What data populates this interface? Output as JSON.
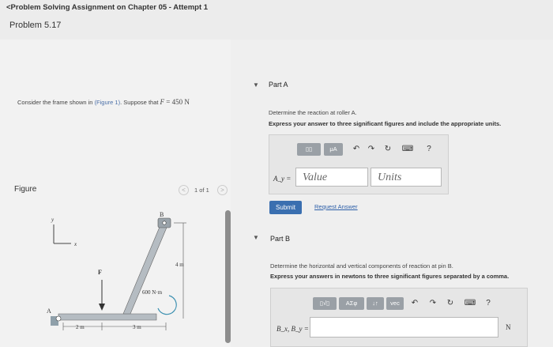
{
  "header": {
    "back_link": "<Problem Solving Assignment on Chapter 05 - Attempt 1",
    "problem_title": "Problem 5.17"
  },
  "question": {
    "prefix": "Consider the frame shown in ",
    "figure_link": "(Figure 1)",
    "middle": ". Suppose that ",
    "var": "F",
    "eq": " = 450 N"
  },
  "figure_panel": {
    "label": "Figure",
    "prev": "<",
    "count": "1 of 1",
    "next": ">"
  },
  "figure": {
    "label_y": "y",
    "label_x": "x",
    "label_B": "B",
    "label_A": "A",
    "label_F": "F",
    "label_4m": "4 m",
    "label_moment": "600 N·m",
    "label_2m": "2 m",
    "label_3m": "3 m"
  },
  "part_a": {
    "caret": "▼",
    "title": "Part A",
    "instruction": "Determine the reaction at roller A.",
    "bold_instruction": "Express your answer to three significant figures and include the appropriate units.",
    "toolbar": {
      "templates": "▯▯",
      "mu": "μA",
      "undo": "↶",
      "redo": "↷",
      "reset": "↻",
      "keyboard": "⌨",
      "help": "?"
    },
    "input_label": "A_y =",
    "value_placeholder": "Value",
    "units_placeholder": "Units",
    "submit": "Submit",
    "request_answer": "Request Answer"
  },
  "part_b": {
    "caret": "▼",
    "title": "Part B",
    "instruction": "Determine the horizontal and vertical components of reaction at pin B.",
    "bold_instruction": "Express your answers in newtons to three significant figures separated by a comma.",
    "toolbar": {
      "templates": "▯√▯",
      "greek": "ΑΣφ",
      "arrows": "↓↑",
      "vec": "vec",
      "undo": "↶",
      "redo": "↷",
      "reset": "↻",
      "keyboard": "⌨",
      "help": "?"
    },
    "input_label": "B_x, B_y =",
    "unit": "N"
  }
}
